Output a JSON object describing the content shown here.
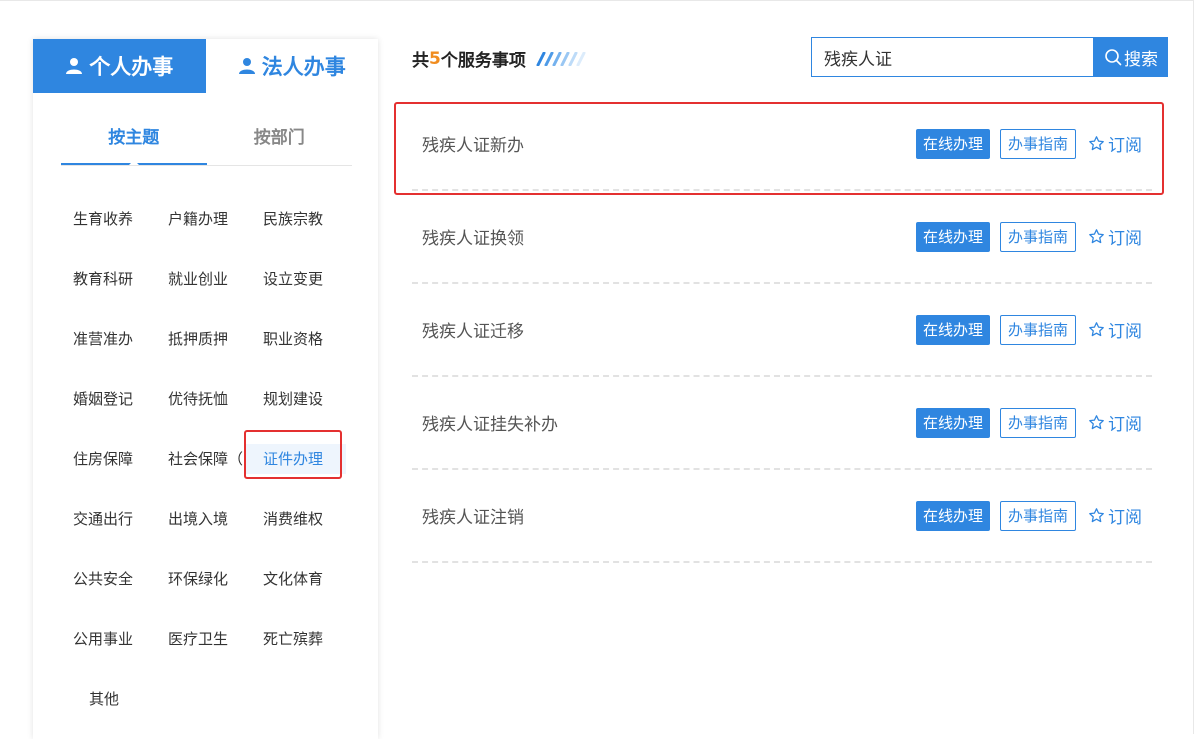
{
  "sidebar": {
    "type_tabs": [
      {
        "label": "个人办事",
        "icon": "user-icon"
      },
      {
        "label": "法人办事",
        "icon": "user-icon"
      }
    ],
    "group_tabs": [
      "按主题",
      "按部门"
    ],
    "topics": [
      "生育收养",
      "户籍办理",
      "民族宗教",
      "教育科研",
      "就业创业",
      "设立变更",
      "准营准办",
      "抵押质押",
      "职业资格",
      "婚姻登记",
      "优待抚恤",
      "规划建设",
      "住房保障",
      "社会保障（...",
      "证件办理",
      "交通出行",
      "出境入境",
      "消费维权",
      "公共安全",
      "环保绿化",
      "文化体育",
      "公用事业",
      "医疗卫生",
      "死亡殡葬",
      "其他"
    ],
    "selected_topic": "证件办理"
  },
  "summary": {
    "prefix": "共",
    "count": "5",
    "suffix": "个服务事项"
  },
  "search": {
    "value": "残疾人证",
    "button_label": "搜索"
  },
  "items": [
    {
      "name": "残疾人证新办"
    },
    {
      "name": "残疾人证换领"
    },
    {
      "name": "残疾人证迁移"
    },
    {
      "name": "残疾人证挂失补办"
    },
    {
      "name": "残疾人证注销"
    }
  ],
  "item_actions": {
    "online": "在线办理",
    "guide": "办事指南",
    "subscribe": "订阅"
  },
  "colors": {
    "accent": "#2f86e0",
    "highlight": "#e43030",
    "count": "#f08c1e"
  }
}
